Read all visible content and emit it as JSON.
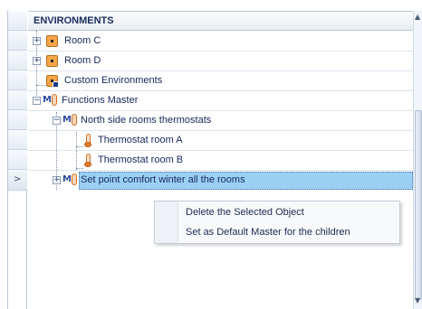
{
  "header": {
    "title": "ENVIRONMENTS"
  },
  "tree": {
    "items": [
      {
        "label": "Room C",
        "icon": "environment-icon",
        "expander": "+"
      },
      {
        "label": "Room D",
        "icon": "environment-icon",
        "expander": "+"
      },
      {
        "label": "Custom Environments",
        "icon": "custom-environment-icon"
      },
      {
        "label": "Functions Master",
        "icon": "functions-master-icon",
        "expander": "−"
      },
      {
        "label": "North side rooms thermostats",
        "icon": "functions-master-icon",
        "expander": "−"
      },
      {
        "label": "Thermostat room A",
        "icon": "thermostat-icon"
      },
      {
        "label": "Thermostat room B",
        "icon": "thermostat-icon"
      },
      {
        "label": "Set point comfort winter all the rooms",
        "icon": "functions-master-icon",
        "expander": "+",
        "selected": true
      }
    ]
  },
  "gutter": {
    "current_row_marker": ">"
  },
  "context_menu": {
    "items": [
      {
        "label": "Delete the Selected Object"
      },
      {
        "label": "Set as Default Master for the children"
      }
    ]
  },
  "scrollbar": {
    "up_glyph": "▲",
    "down_glyph": "▼"
  },
  "colors": {
    "selection": "#9bd0f5",
    "environment_icon": "#f5a54a",
    "thermostat": "#e87c2a",
    "text": "#16285a"
  }
}
